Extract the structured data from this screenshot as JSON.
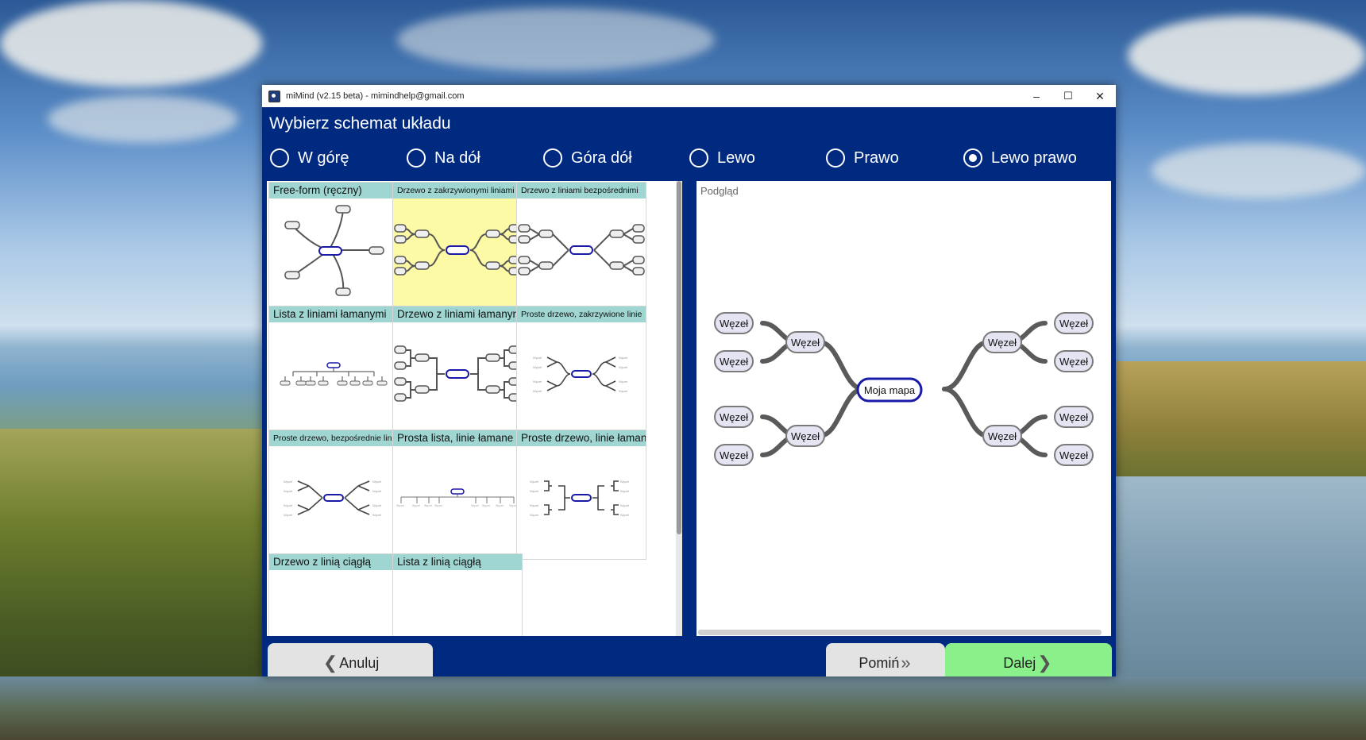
{
  "window": {
    "title": "miMind (v2.15 beta) - mimindhelp@gmail.com",
    "controls": {
      "minimize": "–",
      "maximize": "☐",
      "close": "✕"
    }
  },
  "heading": "Wybierz schemat układu",
  "directions": [
    {
      "label": "W górę",
      "checked": false
    },
    {
      "label": "Na dół",
      "checked": false
    },
    {
      "label": "Góra dół",
      "checked": false
    },
    {
      "label": "Lewo",
      "checked": false
    },
    {
      "label": "Prawo",
      "checked": false
    },
    {
      "label": "Lewo prawo",
      "checked": true
    }
  ],
  "layouts": [
    {
      "label": "Free-form (ręczny)",
      "small": false,
      "selected": false
    },
    {
      "label": "Drzewo z zakrzywionymi liniami",
      "small": true,
      "selected": true
    },
    {
      "label": "Drzewo z liniami bezpośrednimi",
      "small": true,
      "selected": false
    },
    {
      "label": "Lista z liniami łamanymi",
      "small": false,
      "selected": false
    },
    {
      "label": "Drzewo z liniami łamanymi",
      "small": false,
      "selected": false
    },
    {
      "label": "Proste drzewo, zakrzywione linie",
      "small": true,
      "selected": false
    },
    {
      "label": "Proste drzewo, bezpośrednie linie",
      "small": true,
      "selected": false
    },
    {
      "label": "Prosta lista, linie łamane",
      "small": false,
      "selected": false
    },
    {
      "label": "Proste drzewo, linie łamane",
      "small": false,
      "selected": false
    },
    {
      "label": "Drzewo z linią ciągłą",
      "small": false,
      "selected": false
    },
    {
      "label": "Lista z linią ciągłą",
      "small": false,
      "selected": false
    }
  ],
  "preview": {
    "label": "Podgląd",
    "root": "Moja mapa",
    "node": "Węzeł"
  },
  "buttons": {
    "cancel": "Anuluj",
    "skip": "Pomiń",
    "next": "Dalej"
  },
  "colors": {
    "window_bg": "#002a80",
    "tile_header": "#9fd6d2",
    "selected_tile": "#fdfaa5",
    "next_button": "#8af08a",
    "root_border": "#1a1aa8"
  }
}
